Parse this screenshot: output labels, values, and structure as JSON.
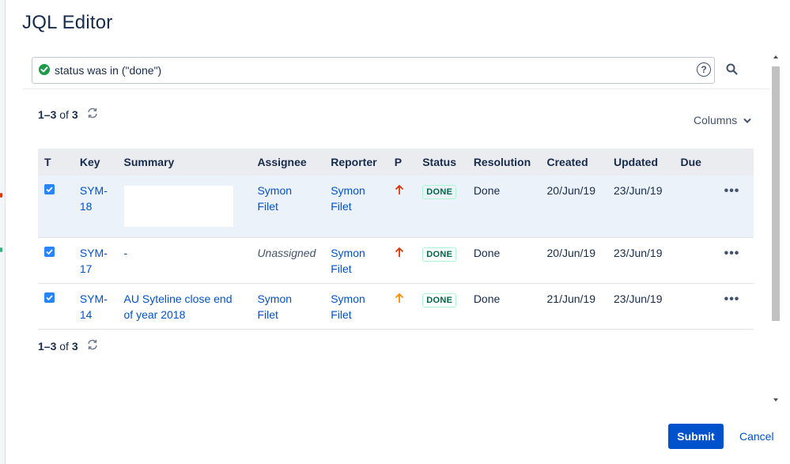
{
  "dialog": {
    "title": "JQL Editor",
    "query": "status was in (\"done\")",
    "help_glyph": "?"
  },
  "pager": {
    "top": {
      "range": "1–3",
      "of": "of",
      "total": "3"
    },
    "bottom": {
      "range": "1–3",
      "of": "of",
      "total": "3"
    }
  },
  "columns_button": "Columns",
  "table": {
    "headers": [
      "T",
      "Key",
      "Summary",
      "Assignee",
      "Reporter",
      "P",
      "Status",
      "Resolution",
      "Created",
      "Updated",
      "Due"
    ],
    "rows": [
      {
        "selected": true,
        "key_line1": "SYM-",
        "key_line2": "18",
        "summary": "",
        "assignee_line1": "Symon",
        "assignee_line2": "Filet",
        "reporter_line1": "Symon",
        "reporter_line2": "Filet",
        "priority_icon": "arrow-up-red",
        "status": "DONE",
        "resolution": "Done",
        "created": "20/Jun/19",
        "updated": "23/Jun/19",
        "due": "",
        "actions": "•••"
      },
      {
        "selected": false,
        "key_line1": "SYM-",
        "key_line2": "17",
        "summary": "-",
        "assignee": "Unassigned",
        "reporter_line1": "Symon",
        "reporter_line2": "Filet",
        "priority_icon": "arrow-up-red",
        "status": "DONE",
        "resolution": "Done",
        "created": "20/Jun/19",
        "updated": "23/Jun/19",
        "due": "",
        "actions": "•••"
      },
      {
        "selected": false,
        "key_line1": "SYM-",
        "key_line2": "14",
        "summary_line1": "AU Syteline close end",
        "summary_line2": "of year 2018",
        "assignee_line1": "Symon",
        "assignee_line2": "Filet",
        "reporter_line1": "Symon",
        "reporter_line2": "Filet",
        "priority_icon": "arrow-up-orange",
        "status": "DONE",
        "resolution": "Done",
        "created": "21/Jun/19",
        "updated": "23/Jun/19",
        "due": "",
        "actions": "•••"
      }
    ]
  },
  "footer": {
    "submit": "Submit",
    "cancel": "Cancel"
  },
  "colors": {
    "primary": "#0052cc",
    "success": "#1e9a4a",
    "priority_high": "#de350b",
    "priority_medium": "#ff8b00",
    "lozenge_text": "#006644",
    "selected_row": "#ebf2fa",
    "header_bg": "#ebecf0"
  }
}
